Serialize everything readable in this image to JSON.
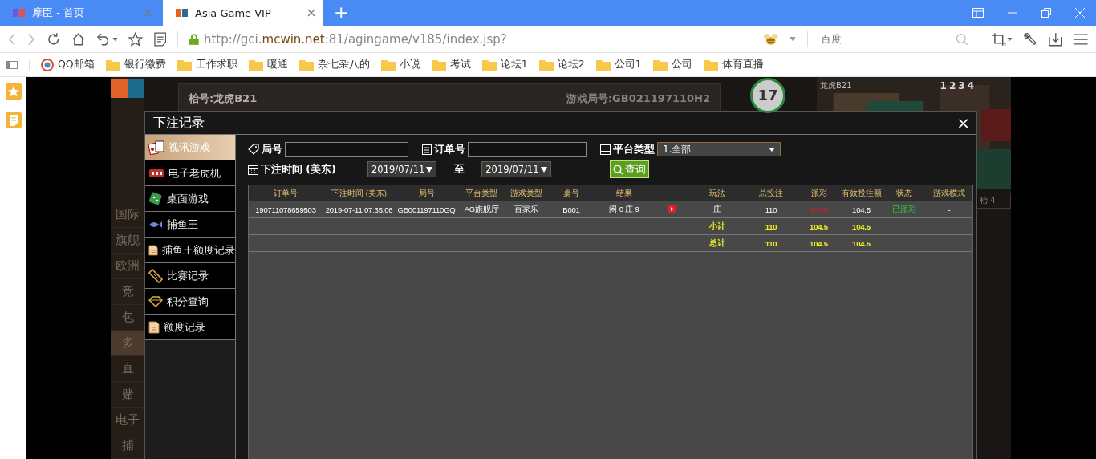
{
  "browser": {
    "tabs": [
      {
        "title": "摩臣 - 首页",
        "selected": false
      },
      {
        "title": "Asia Game VIP",
        "selected": true
      }
    ],
    "new_tab": "+",
    "url": {
      "prefix": "http://gci.",
      "domain": "mcwin.net",
      "suffix": ":81/agingame/v185/index.jsp?"
    },
    "search_placeholder": "百度",
    "bookmarks": [
      {
        "label": "QQ邮箱",
        "kind": "mail"
      },
      {
        "label": "银行缴费",
        "kind": "folder"
      },
      {
        "label": "工作求职",
        "kind": "folder"
      },
      {
        "label": "暖通",
        "kind": "folder"
      },
      {
        "label": "杂七杂八的",
        "kind": "folder"
      },
      {
        "label": "小说",
        "kind": "folder"
      },
      {
        "label": "考试",
        "kind": "folder"
      },
      {
        "label": "论坛1",
        "kind": "folder"
      },
      {
        "label": "论坛2",
        "kind": "folder"
      },
      {
        "label": "公司1",
        "kind": "folder"
      },
      {
        "label": "公司",
        "kind": "folder"
      },
      {
        "label": "体育直播",
        "kind": "folder"
      }
    ]
  },
  "game": {
    "table_label": "枱号:龙虎B21",
    "round_no": "游戏局号:GB021197110H2",
    "counter": "17",
    "video_title": "龙虎B21",
    "seats": [
      "1",
      "2",
      "3",
      "4"
    ],
    "seat_tab": "枱 4",
    "side_items": [
      {
        "label": "国际",
        "selected": false
      },
      {
        "label": "旗舰",
        "selected": false
      },
      {
        "label": "欧洲",
        "selected": false
      },
      {
        "label": "竞",
        "selected": false
      },
      {
        "label": "包",
        "selected": false
      },
      {
        "label": "多",
        "selected": true
      },
      {
        "label": "直",
        "selected": false
      },
      {
        "label": "赌",
        "selected": false
      },
      {
        "label": "电子",
        "selected": false
      },
      {
        "label": "捕",
        "selected": false
      }
    ]
  },
  "dialog": {
    "title": "下注记录",
    "close": "×",
    "menu": [
      {
        "label": "视讯游戏",
        "selected": true
      },
      {
        "label": "电子老虎机",
        "selected": false
      },
      {
        "label": "桌面游戏",
        "selected": false
      },
      {
        "label": "捕鱼王",
        "selected": false
      },
      {
        "label": "捕鱼王额度记录",
        "selected": false
      },
      {
        "label": "比赛记录",
        "selected": false
      },
      {
        "label": "积分查询",
        "selected": false
      },
      {
        "label": "额度记录",
        "selected": false
      }
    ],
    "filters": {
      "round_label": "局号",
      "order_label": "订单号",
      "platform_label": "平台类型",
      "platform_value": "1.全部",
      "time_label": "下注时间 (美东)",
      "date_from": "2019/07/11",
      "to_label": "至",
      "date_to": "2019/07/11",
      "query_button": "查询"
    },
    "table": {
      "columns": [
        "订单号",
        "下注时间 (美东)",
        "局号",
        "平台类型",
        "游戏类型",
        "桌号",
        "结果",
        "",
        "玩法",
        "总投注",
        "派彩",
        "有效投注额",
        "状态",
        "游戏模式"
      ],
      "rows": [
        {
          "order": "190711078659503",
          "time": "2019-07-11 07:35:06",
          "round": "GB001197110GQ",
          "platform": "AG旗舰厅",
          "game_type": "百家乐",
          "table": "B001",
          "result": "闲 0 庄 9",
          "video": true,
          "play": "庄",
          "total_bet": "110",
          "payout": "104.5",
          "valid_bet": "104.5",
          "status": "已派彩",
          "mode": "-"
        }
      ],
      "subtotal": {
        "label": "小计",
        "total_bet": "110",
        "payout": "104.5",
        "valid_bet": "104.5"
      },
      "total": {
        "label": "总计",
        "total_bet": "110",
        "payout": "104.5",
        "valid_bet": "104.5"
      }
    }
  }
}
